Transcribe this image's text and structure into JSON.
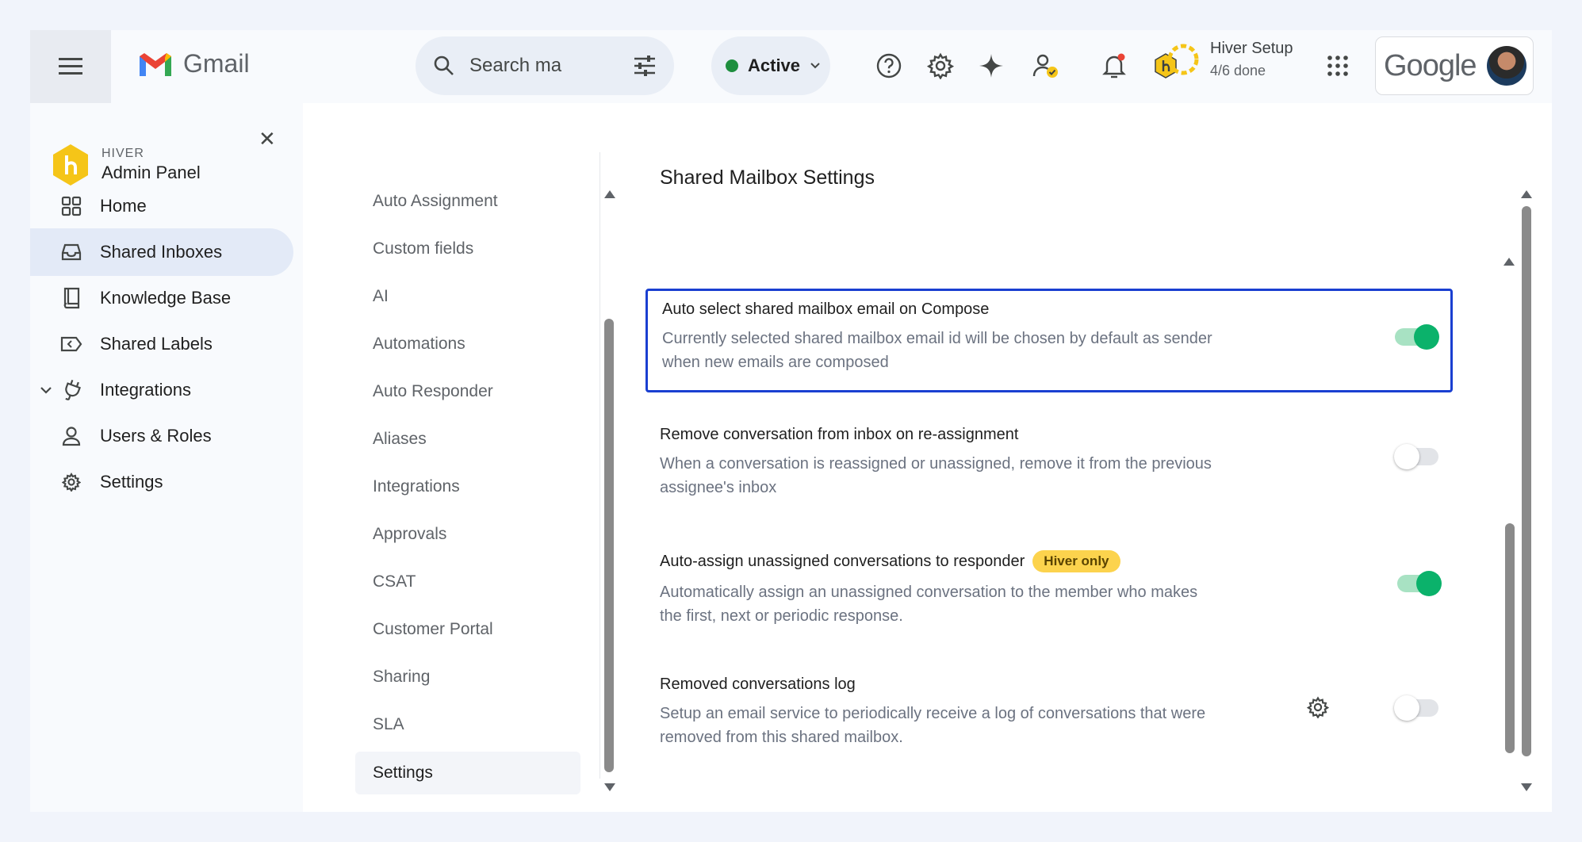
{
  "header": {
    "gmail_label": "Gmail",
    "search_placeholder": "Search ma",
    "status_label": "Active",
    "setup_title": "Hiver Setup",
    "setup_progress": "4/6 done",
    "google_label": "Google"
  },
  "nav": {
    "brand_small": "HIVER",
    "brand_big": "Admin Panel",
    "items": [
      {
        "label": "Home",
        "icon": "grid-icon"
      },
      {
        "label": "Shared Inboxes",
        "icon": "inbox-icon"
      },
      {
        "label": "Knowledge Base",
        "icon": "book-icon"
      },
      {
        "label": "Shared Labels",
        "icon": "label-icon"
      },
      {
        "label": "Integrations",
        "icon": "plug-icon"
      },
      {
        "label": "Users & Roles",
        "icon": "user-icon"
      },
      {
        "label": "Settings",
        "icon": "gear-icon"
      }
    ],
    "active_item": "Shared Inboxes"
  },
  "submenu": {
    "items": [
      "Auto Assignment",
      "Custom fields",
      "AI",
      "Automations",
      "Auto Responder",
      "Aliases",
      "Integrations",
      "Approvals",
      "CSAT",
      "Customer Portal",
      "Sharing",
      "SLA",
      "Settings"
    ],
    "active_item": "Settings"
  },
  "content": {
    "title": "Shared Mailbox Settings",
    "settings": [
      {
        "title": "Auto select shared mailbox email on Compose",
        "description": "Currently selected shared mailbox email id will be chosen by default as sender when new emails are composed",
        "enabled": true
      },
      {
        "title": "Remove conversation from inbox on re-assignment",
        "description": "When a conversation is reassigned or unassigned, remove it from the previous assignee's inbox",
        "enabled": false
      },
      {
        "title": "Auto-assign unassigned conversations to responder",
        "badge": "Hiver only",
        "description": "Automatically assign an unassigned conversation to the member who makes the first, next or periodic response.",
        "enabled": true
      },
      {
        "title": "Removed conversations log",
        "description": "Setup an email service to periodically receive a log of conversations that were removed from this shared mailbox.",
        "enabled": false
      }
    ]
  },
  "colors": {
    "accent_green": "#0bb26b",
    "highlight_border": "#1a3fd1",
    "badge_yellow": "#fcd34d",
    "hiver_yellow": "#f5c518"
  }
}
